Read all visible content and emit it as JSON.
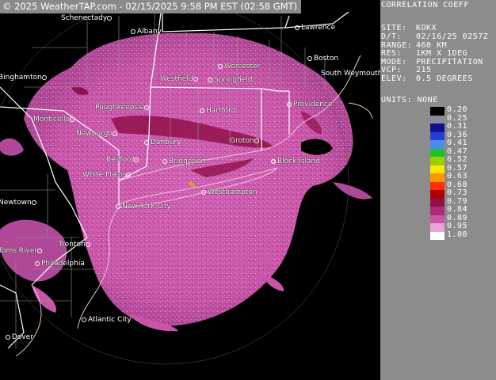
{
  "banner": "© 2025 WeatherTAP.com - 02/15/2025  9:58 PM EST (02:58 GMT)",
  "panel": {
    "title": "CORRELATION COEFF",
    "rows": [
      {
        "label": "SITE:",
        "value": "KOKX"
      },
      {
        "label": "D/T:",
        "value": "02/16/25 0257Z"
      },
      {
        "label": "RANGE:",
        "value": "460 KM"
      },
      {
        "label": "RES:",
        "value": "1KM X 1DEG"
      },
      {
        "label": "MODE:",
        "value": "PRECIPITATION"
      },
      {
        "label": "VCP:",
        "value": "215"
      },
      {
        "label": "ELEV:",
        "value": "0.5 DEGREES"
      }
    ],
    "units_label": "UNITS: NONE"
  },
  "scale": [
    {
      "value": "0.20",
      "color": "#000000"
    },
    {
      "value": "0.25",
      "color": "#8a8a9a"
    },
    {
      "value": "0.31",
      "color": "#101090"
    },
    {
      "value": "0.36",
      "color": "#2540d0"
    },
    {
      "value": "0.41",
      "color": "#4c8cf0"
    },
    {
      "value": "0.47",
      "color": "#20c028"
    },
    {
      "value": "0.52",
      "color": "#98d000"
    },
    {
      "value": "0.57",
      "color": "#ffe800"
    },
    {
      "value": "0.63",
      "color": "#ff9800"
    },
    {
      "value": "0.68",
      "color": "#ff3000"
    },
    {
      "value": "0.73",
      "color": "#b00000"
    },
    {
      "value": "0.79",
      "color": "#90104a"
    },
    {
      "value": "0.84",
      "color": "#b02a7a"
    },
    {
      "value": "0.89",
      "color": "#c855a8"
    },
    {
      "value": "0.95",
      "color": "#e8a4d6"
    },
    {
      "value": "1.00",
      "color": "#ffffff"
    }
  ],
  "cities": [
    {
      "name": "Schenectady"
    },
    {
      "name": "Albany"
    },
    {
      "name": "Lawrence"
    },
    {
      "name": "Worcester"
    },
    {
      "name": "Boston"
    },
    {
      "name": "Westfield"
    },
    {
      "name": "Springfield"
    },
    {
      "name": "South Weymouth"
    },
    {
      "name": "Binghamton"
    },
    {
      "name": "Poughkeepsie"
    },
    {
      "name": "Hartford"
    },
    {
      "name": "Providence"
    },
    {
      "name": "Monticello"
    },
    {
      "name": "Newburgh"
    },
    {
      "name": "Danbury"
    },
    {
      "name": "Groton"
    },
    {
      "name": "Bedford"
    },
    {
      "name": "Bridgeport"
    },
    {
      "name": "Block Island"
    },
    {
      "name": "White Plains"
    },
    {
      "name": "Westhampton"
    },
    {
      "name": "Newtown"
    },
    {
      "name": "New York City"
    },
    {
      "name": "Trenton"
    },
    {
      "name": "Toms River"
    },
    {
      "name": "Philadelphia"
    },
    {
      "name": "Atlantic City"
    },
    {
      "name": "Dover"
    }
  ],
  "colors": {
    "radar_main": "#c855a8",
    "radar_dark": "#90104a",
    "panel_bg": "#8c8c8c",
    "banner_bg": "#8a8a8a",
    "state_lines": "#ffffff",
    "county_lines": "#b0b0b0",
    "coast_lines": "#f0c0d0"
  }
}
